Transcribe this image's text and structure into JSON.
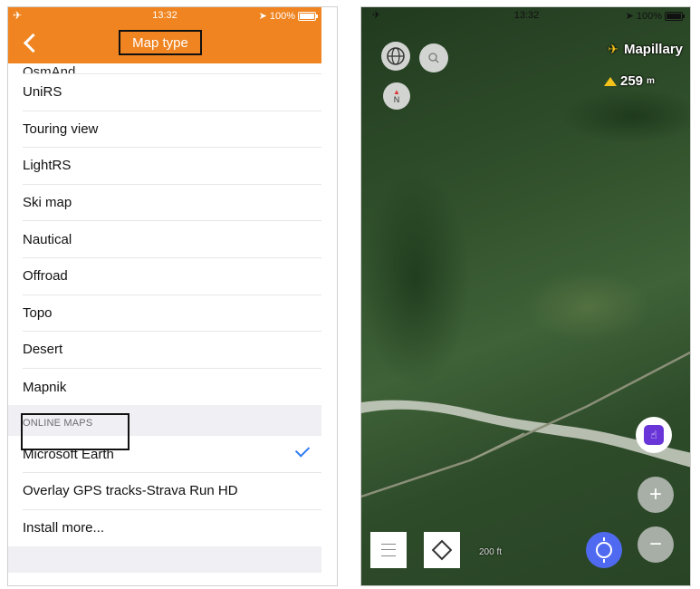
{
  "left_screen": {
    "status": {
      "time": "13:32",
      "battery": "100%"
    },
    "title": "Map type",
    "partial_item": "OsmAnd",
    "items": [
      "UniRS",
      "Touring view",
      "LightRS",
      "Ski map",
      "Nautical",
      "Offroad",
      "Topo",
      "Desert",
      "Mapnik"
    ],
    "section_header": "ONLINE MAPS",
    "online_items": [
      {
        "label": "Microsoft Earth",
        "selected": true
      },
      {
        "label": "Overlay GPS tracks-Strava Run HD",
        "selected": false
      },
      {
        "label": "Install more...",
        "selected": false
      }
    ],
    "accent_color": "#ef8420",
    "check_color": "#2f7bf5"
  },
  "right_screen": {
    "status": {
      "time": "13:32",
      "battery": "100%"
    },
    "mapillary_label": "Mapillary",
    "elevation_value": "259",
    "elevation_unit": "m",
    "compass_label": "N",
    "scale_label": "200 ft",
    "locate_color": "#4f6af1",
    "touch_color": "#6a35d8"
  }
}
